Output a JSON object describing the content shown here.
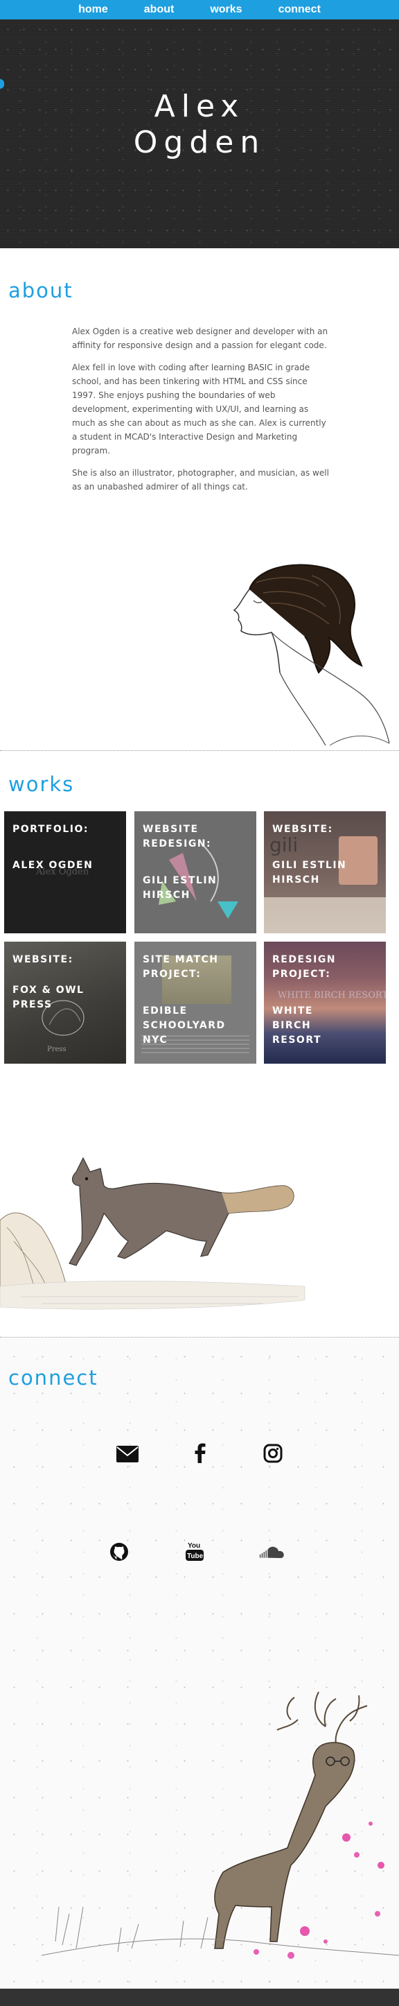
{
  "nav": {
    "items": [
      "home",
      "about",
      "works",
      "connect"
    ]
  },
  "hero": {
    "first_name": "Alex",
    "last_name": "Ogden"
  },
  "about": {
    "title": "about",
    "paragraphs": [
      "Alex Ogden is a creative web designer and developer with an affinity for responsive design and a passion for elegant code.",
      "Alex fell in love with coding after learning BASIC in grade school, and has been tinkering with HTML and CSS since 1997. She enjoys pushing the boundaries of web development, experimenting with UX/UI, and learning as much as she can about as much as she can. Alex is currently a student in MCAD's Interactive Design and Marketing program.",
      "She is also an illustrator, photographer, and musician, as well as an unabashed admirer of all things cat."
    ]
  },
  "works": {
    "title": "works",
    "tiles": [
      {
        "category": "PORTFOLIO:",
        "name": "ALEX OGDEN"
      },
      {
        "category": "WEBSITE REDESIGN:",
        "name": "GILI ESTLIN HIRSCH"
      },
      {
        "category": "WEBSITE:",
        "name": "GILI ESTLIN HIRSCH"
      },
      {
        "category": "WEBSITE:",
        "name": "FOX & OWL PRESS"
      },
      {
        "category": "SITE MATCH PROJECT:",
        "name": "EDIBLE SCHOOLYARD NYC"
      },
      {
        "category": "REDESIGN PROJECT:",
        "name": "WHITE BIRCH RESORT"
      }
    ],
    "thumb_texts": {
      "alex_logo": "Alex Ogden",
      "gili_logo": "gili",
      "fox_owl": "Press",
      "white_birch": "WHITE BIRCH RESORT"
    }
  },
  "connect": {
    "title": "connect",
    "icons": [
      "email-icon",
      "facebook-icon",
      "instagram-icon",
      "github-icon",
      "youtube-icon",
      "soundcloud-icon"
    ]
  },
  "colors": {
    "accent": "#1e9fe0",
    "hero_bg": "#2b2b2b",
    "footer": "#333333"
  }
}
